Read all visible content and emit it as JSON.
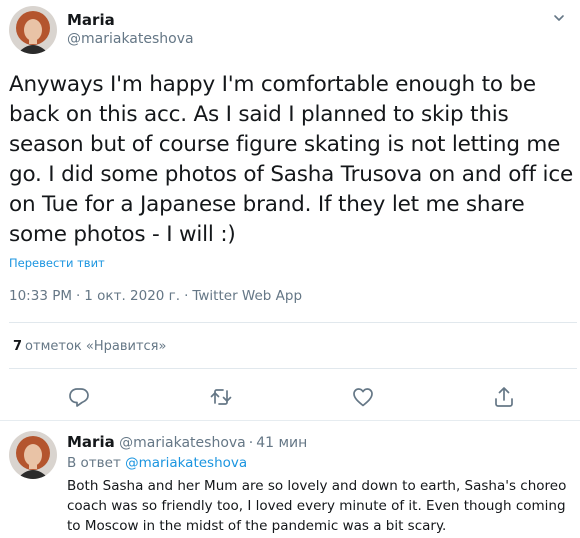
{
  "tweet": {
    "author": {
      "name": "Maria",
      "handle": "@mariakateshova"
    },
    "text": "Anyways I'm happy I'm comfortable enough to be back on this acc. As I said I planned to skip this season but of course figure skating is not letting me go. I did some photos of Sasha Trusova on and off ice on Tue for a Japanese brand. If they let me share some photos - I will :)",
    "translate_label": "Перевести твит",
    "time": "10:33 PM",
    "date": "1 окт. 2020 г.",
    "source": "Twitter Web App",
    "dot": "·",
    "likes": {
      "count": "7",
      "label": "отметок «Нравится»"
    },
    "actions": [
      "reply-icon",
      "retweet-icon",
      "like-icon",
      "share-icon"
    ],
    "caret_icon": "chevron-down-icon"
  },
  "reply": {
    "author": {
      "name": "Maria",
      "handle": "@mariakateshova"
    },
    "dot": "·",
    "time_ago": "41 мин",
    "in_reply_to_label": "В ответ",
    "in_reply_to_handle": "@mariakateshova",
    "text": "Both Sasha and her Mum are so lovely and down to earth, Sasha's choreo coach was so friendly too, I loved every minute of it. Even though coming to Moscow in the midst of the pandemic was a bit scary."
  },
  "colors": {
    "text": "#14171a",
    "secondary": "#657786",
    "link": "#1b95e0",
    "divider": "#e1e8ed"
  }
}
